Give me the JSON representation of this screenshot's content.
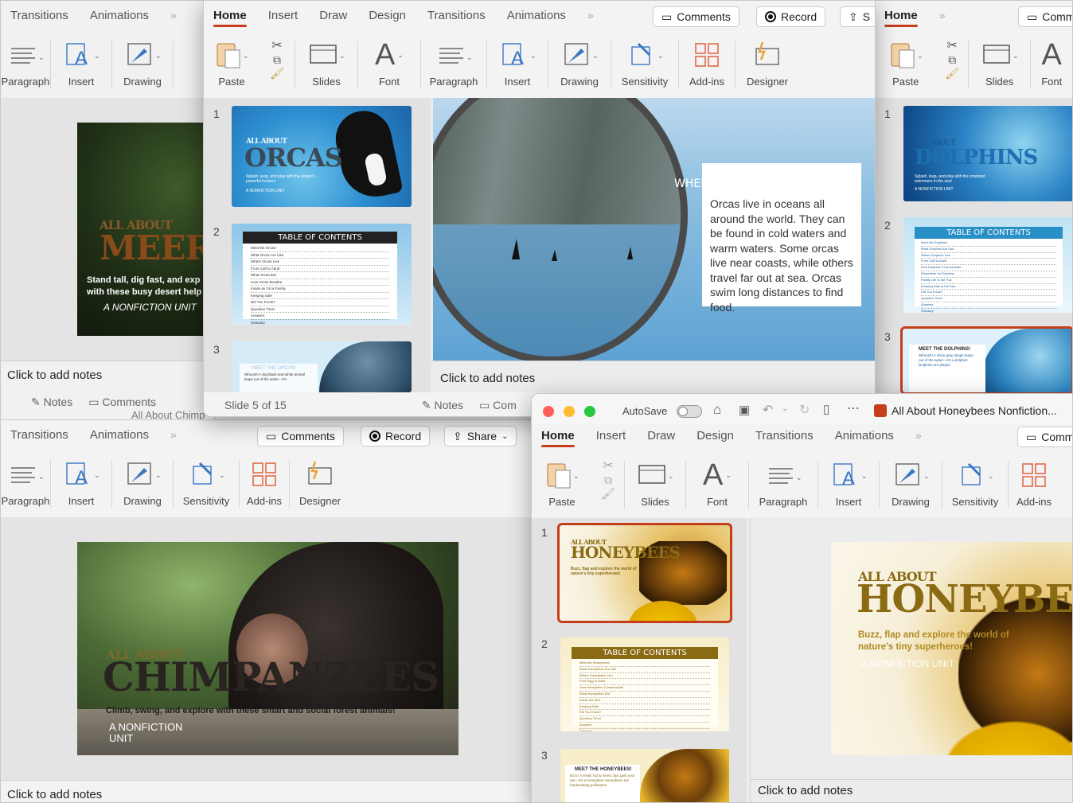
{
  "window_back_left": {
    "tabs": [
      "Transitions",
      "Animations"
    ],
    "ribbon": [
      "Paragraph",
      "Insert",
      "Drawing"
    ],
    "slide": {
      "line1": "ALL ABOUT",
      "title": "MEERK",
      "subtitle": "Stand tall, dig fast, and exp",
      "subtitle2": "with these busy desert help",
      "unit": "A NONFICTION UNIT"
    },
    "notes": "Click to add notes",
    "status": {
      "notes": "Notes",
      "comments": "Comments"
    },
    "under_title": "All About Chimp"
  },
  "window_orcas": {
    "tabs": [
      "Home",
      "Insert",
      "Draw",
      "Design",
      "Transitions",
      "Animations"
    ],
    "buttons": {
      "comments": "Comments",
      "record": "Record",
      "share": "S"
    },
    "ribbon": [
      "Paste",
      "Slides",
      "Font",
      "Paragraph",
      "Insert",
      "Drawing",
      "Sensitivity",
      "Add-ins",
      "Designer"
    ],
    "thumbs": [
      {
        "num": "1",
        "line1": "ALL ABOUT",
        "title": "ORCAS",
        "sub": "Splash, leap, and play with the ocean's powerful hunters",
        "unit": "A NONFICTION UNIT"
      },
      {
        "num": "2",
        "title": "TABLE OF CONTENTS",
        "items": [
          "Meet the Orcas!",
          "What Orcas Are Like",
          "Where Orcas Live",
          "From Calf to Adult",
          "What Orcas Eat",
          "How Orcas Breathe",
          "Inside an Orca Family",
          "Keeping Safe",
          "Did You Know?",
          "Question Time!",
          "Answers",
          "Glossary"
        ]
      },
      {
        "num": "3",
        "title": "MEET THE ORCAS!",
        "text": "Whoosh! A big black-and-white animal leaps out of the water—it's"
      }
    ],
    "main": {
      "heading": "WHERE ORCAS LIVE",
      "body": "Orcas live in oceans all around the world. They can be found in cold waters and warm waters. Some orcas live near coasts, while others travel far out at sea. Orcas swim long distances to find food."
    },
    "notes": "Click to add notes",
    "status": {
      "slide": "Slide 5 of 15",
      "notes": "Notes",
      "comments": "Com"
    }
  },
  "window_dolphins": {
    "tabs": [
      "Home"
    ],
    "buttons": {
      "comments": "Comm"
    },
    "ribbon": [
      "Paste",
      "Slides",
      "Font"
    ],
    "thumbs": [
      {
        "num": "1",
        "line1": "ALL ABOUT",
        "title": "DOLPHINS",
        "sub": "Splash, leap, and play with the smartest swimmers in the sea!",
        "unit": "A NONFICTION UNIT"
      },
      {
        "num": "2",
        "title": "TABLE OF CONTENTS",
        "items": [
          "Meet the Dolphins!",
          "What Dolphins Are Like",
          "Where Dolphins Live",
          "From Calf to Adult",
          "How Dolphins Communicate",
          "Dinnertime for Dolphins",
          "Family Life in the Pod",
          "Keeping Safe in the Sea",
          "Did You Know?",
          "Question Time!",
          "Answers",
          "Glossary"
        ]
      },
      {
        "num": "3",
        "title": "MEET THE DOLPHINS!",
        "text": "Whoosh! A shiny gray shape leaps out of the water—it's a dolphin! Dolphins are playful"
      }
    ]
  },
  "window_chimps": {
    "tabs": [
      "Transitions",
      "Animations"
    ],
    "buttons": {
      "comments": "Comments",
      "record": "Record",
      "share": "Share"
    },
    "ribbon": [
      "Paragraph",
      "Insert",
      "Drawing",
      "Sensitivity",
      "Add-ins",
      "Designer"
    ],
    "slide": {
      "line1": "ALL ABOUT",
      "title": "CHIMPANZEES",
      "subtitle": "Climb, swing, and explore with these smart and social forest animals!",
      "unit": "A NONFICTION UNIT"
    },
    "notes": "Click to add notes"
  },
  "window_bees": {
    "titlebar": {
      "autosave": "AutoSave",
      "doc_title": "All About Honeybees Nonfiction..."
    },
    "tabs": [
      "Home",
      "Insert",
      "Draw",
      "Design",
      "Transitions",
      "Animations"
    ],
    "buttons": {
      "comments": "Comm"
    },
    "ribbon": [
      "Paste",
      "Slides",
      "Font",
      "Paragraph",
      "Insert",
      "Drawing",
      "Sensitivity",
      "Add-ins"
    ],
    "thumbs": [
      {
        "num": "1",
        "line1": "ALL ABOUT",
        "title": "HONEYBEES",
        "sub": "Buzz, flap and explore the world of nature's tiny superheroes!"
      },
      {
        "num": "2",
        "title": "TABLE OF CONTENTS",
        "items": [
          "Meet the Honeybees!",
          "What Honeybees Are Like",
          "Where Honeybees Live",
          "From Egg to Adult",
          "How Honeybees Communicate",
          "What Honeybees Eat",
          "Inside the Hive",
          "Keeping Safe",
          "Did You Know?",
          "Question Time!",
          "Answers",
          "Glossary"
        ]
      },
      {
        "num": "3",
        "title": "MEET THE HONEYBEES!",
        "text": "Bzzz! A small, fuzzy insect zips past your ear—it's a honeybee! Honeybees are hardworking pollinators"
      }
    ],
    "slide": {
      "line1": "ALL ABOUT",
      "title": "HONEYBEES",
      "subtitle": "Buzz, flap and explore the world of nature's tiny superheroes!",
      "unit": "A NONFICTION UNIT"
    },
    "notes": "Click to add notes"
  },
  "colors": {
    "accent": "#c43e1c",
    "bee_gold": "#8a6a12",
    "orca_blue": "#4a9bd0"
  }
}
